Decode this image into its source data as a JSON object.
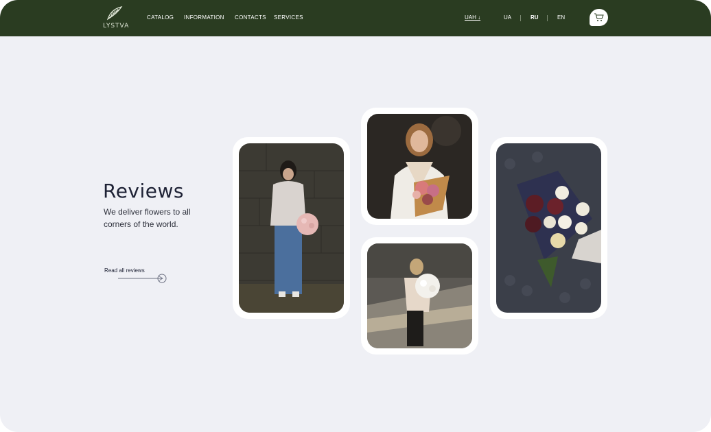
{
  "header": {
    "logo_text": "LYSTVA",
    "nav": [
      {
        "label": "CATALOG"
      },
      {
        "label": "INFORMATION"
      },
      {
        "label": "CONTACTS"
      },
      {
        "label": "SERVICES"
      }
    ],
    "currency": "UAH ↓",
    "languages": [
      {
        "label": "UA"
      },
      {
        "label": "RU"
      },
      {
        "label": "EN"
      }
    ],
    "cart_icon": "cart-icon"
  },
  "reviews": {
    "title": "Reviews",
    "subtitle": "We deliver flowers to all corners of the world.",
    "link_label": "Read all reviews",
    "photos": [
      {
        "icon": "photo-woman-standing-with-pink-bouquet"
      },
      {
        "icon": "photo-woman-with-bouquet-portrait"
      },
      {
        "icon": "photo-woman-with-white-bouquet-street"
      },
      {
        "icon": "photo-bouquet-dark-roses"
      }
    ]
  },
  "colors": {
    "header_bg": "#2a3c21",
    "page_bg": "#eff0f5",
    "text_dark": "#1e2235"
  }
}
